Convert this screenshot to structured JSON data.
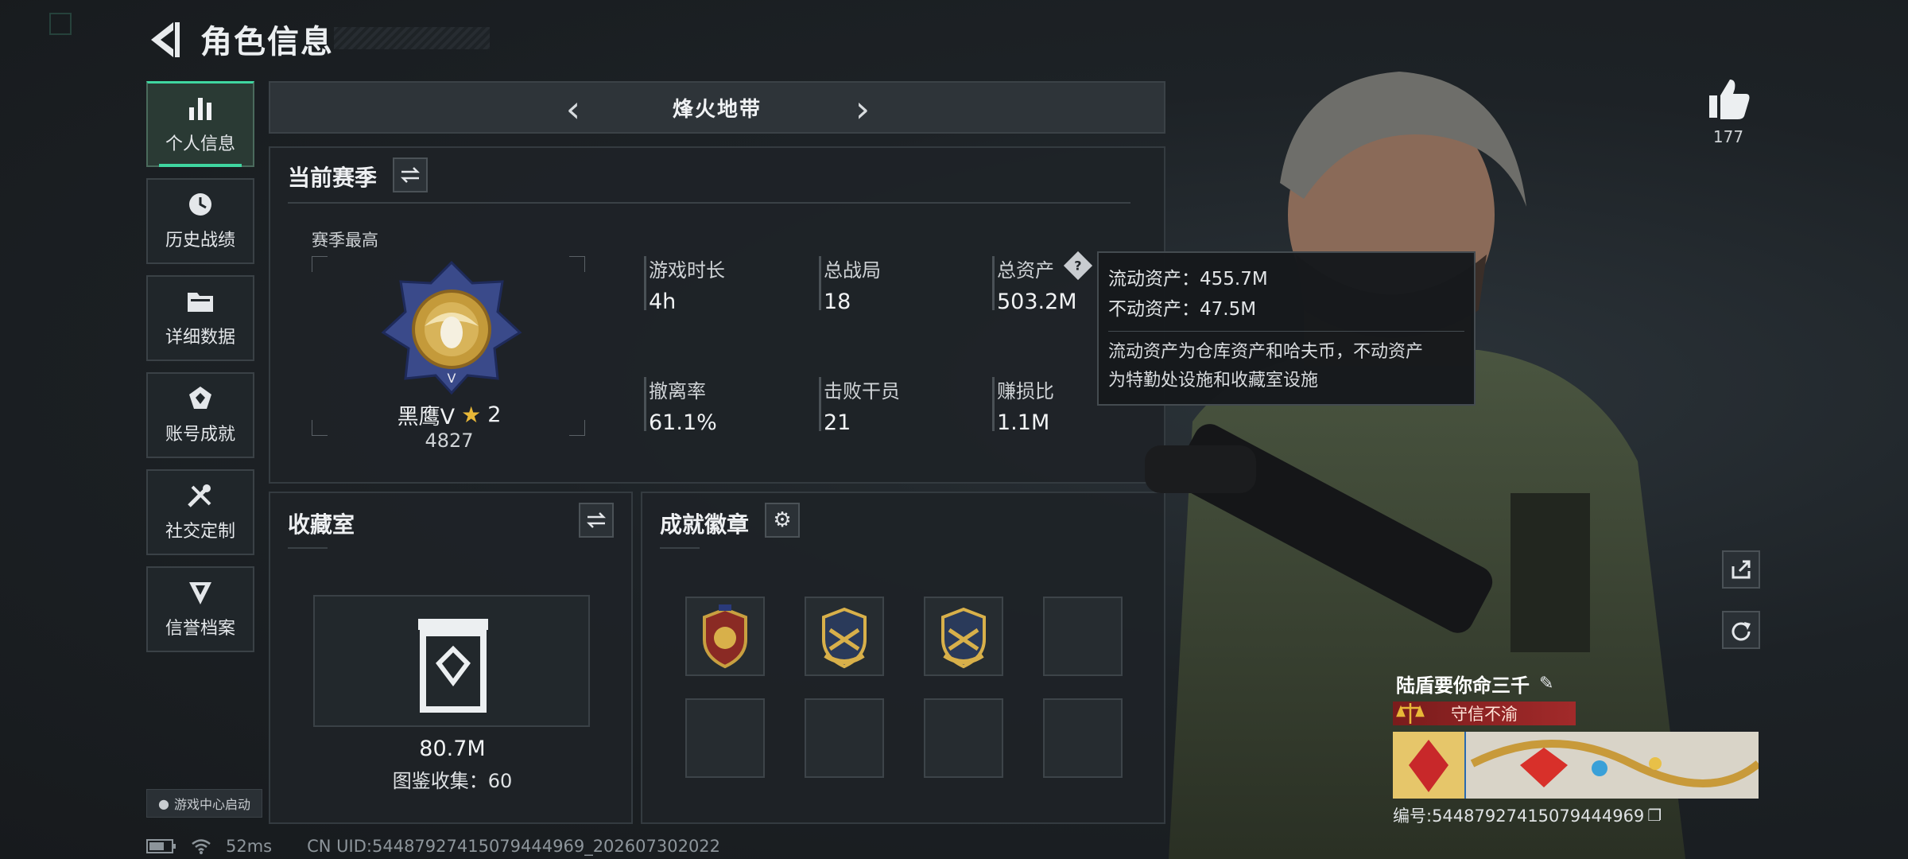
{
  "header": {
    "title": "角色信息"
  },
  "sidebar": {
    "items": [
      {
        "label": "个人信息",
        "icon": "bar-chart-icon",
        "active": true
      },
      {
        "label": "历史战绩",
        "icon": "clock-icon"
      },
      {
        "label": "详细数据",
        "icon": "folder-icon"
      },
      {
        "label": "账号成就",
        "icon": "achievement-icon"
      },
      {
        "label": "社交定制",
        "icon": "tools-icon"
      },
      {
        "label": "信誉档案",
        "icon": "reputation-icon"
      }
    ],
    "game_center": "游戏中心启动"
  },
  "mode": {
    "label": "烽火地带"
  },
  "season": {
    "title": "当前赛季",
    "best_label": "赛季最高",
    "rank_name": "黑鹰V",
    "rank_stars": "2",
    "rank_points": "4827",
    "stats": [
      {
        "label": "游戏时长",
        "value": "4h"
      },
      {
        "label": "总战局",
        "value": "18"
      },
      {
        "label": "总资产",
        "value": "503.2M"
      },
      {
        "label": "撤离率",
        "value": "61.1%"
      },
      {
        "label": "击败干员",
        "value": "21"
      },
      {
        "label": "赚损比",
        "value": "1.1M"
      }
    ]
  },
  "tooltip": {
    "liquid": "流动资产：455.7M",
    "fixed": "不动资产：47.5M",
    "note_line1": "流动资产为仓库资产和哈夫币，不动资产",
    "note_line2": "为特勤处设施和收藏室设施"
  },
  "collection": {
    "title": "收藏室",
    "value": "80.7M",
    "count": "图鉴收集：60"
  },
  "badges": {
    "title": "成就徽章"
  },
  "player": {
    "likes": "177",
    "name": "陆盾要你命三千",
    "reputation": "守信不渝",
    "serial": "编号:5448792741507944496​9"
  },
  "status": {
    "ping": "52ms",
    "uid": "CN UID:5448792741507944496​9_202607302022"
  },
  "colors": {
    "accent": "#3fd6a0",
    "reputation": "#a22a2a",
    "panel": "#1e2327"
  }
}
